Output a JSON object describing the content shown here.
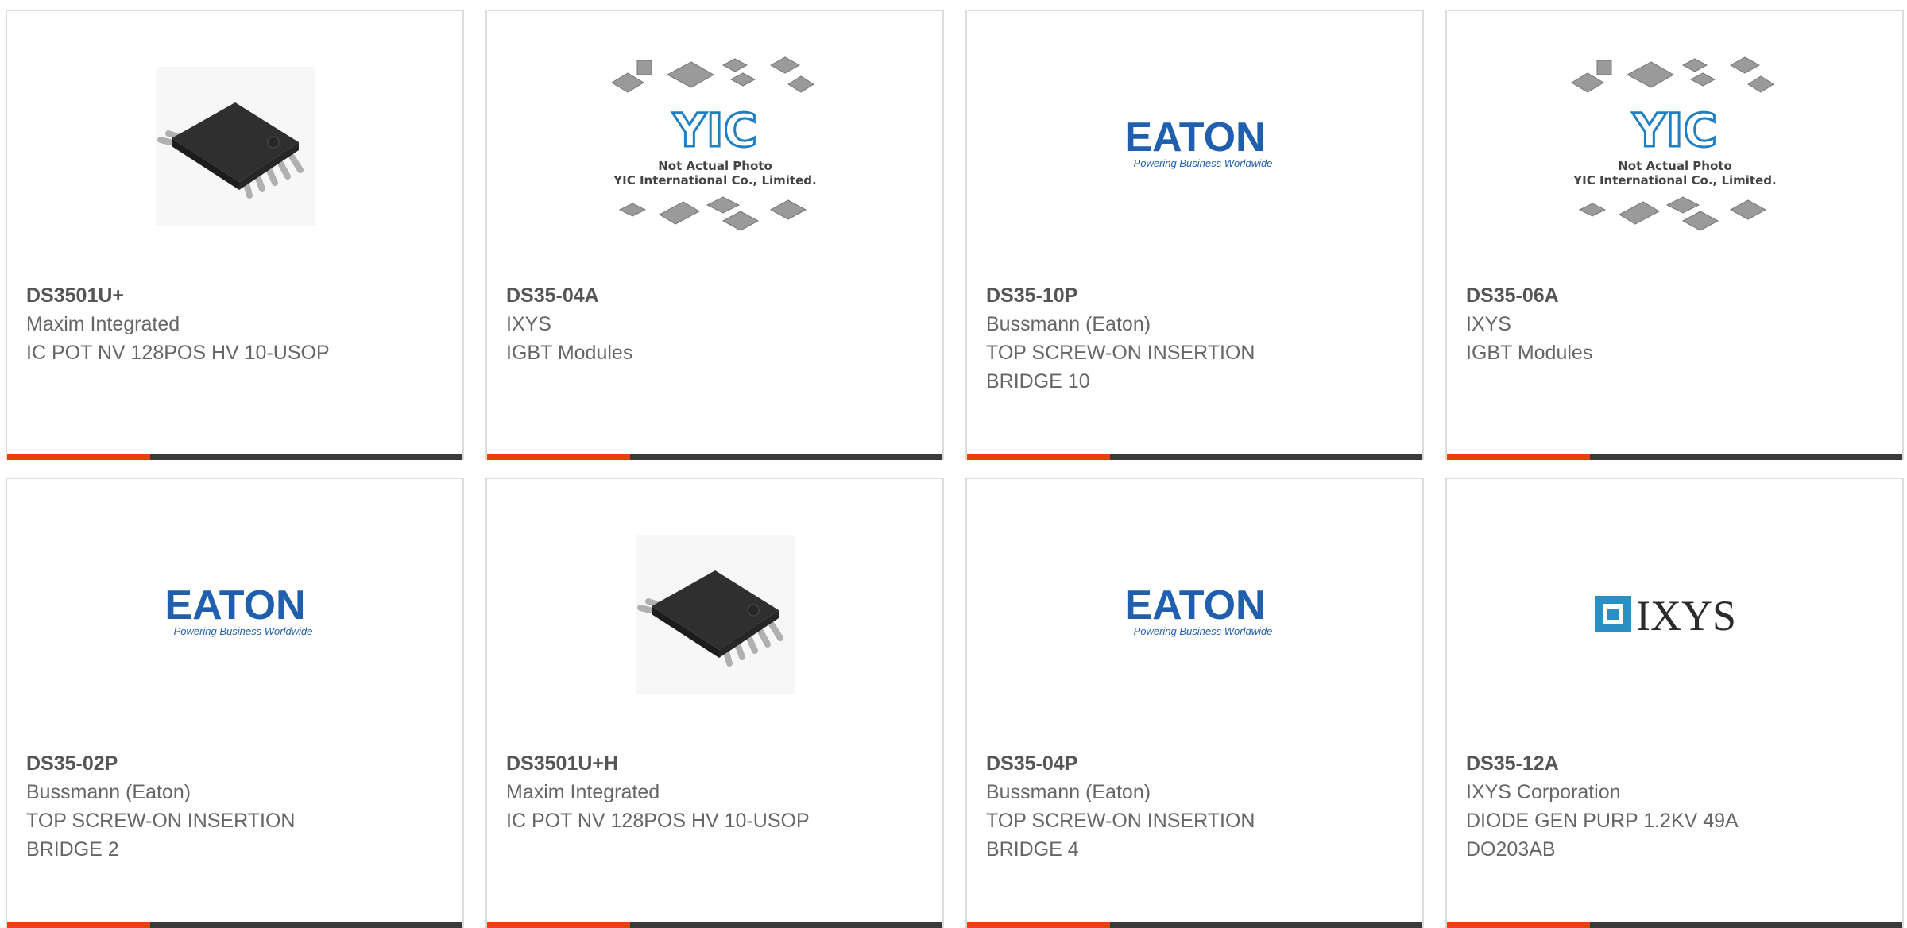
{
  "products": [
    {
      "part": "DS3501U+",
      "manufacturer": "Maxim Integrated",
      "description": "IC POT NV 128POS HV 10-USOP",
      "image": "ic-chip"
    },
    {
      "part": "DS35-04A",
      "manufacturer": "IXYS",
      "description": "IGBT Modules",
      "image": "yic-placeholder"
    },
    {
      "part": "DS35-10P",
      "manufacturer": "Bussmann (Eaton)",
      "description": "TOP SCREW-ON INSERTION BRIDGE 10",
      "image": "eaton-logo"
    },
    {
      "part": "DS35-06A",
      "manufacturer": "IXYS",
      "description": "IGBT Modules",
      "image": "yic-placeholder"
    },
    {
      "part": "DS35-02P",
      "manufacturer": "Bussmann (Eaton)",
      "description": "TOP SCREW-ON INSERTION BRIDGE 2",
      "image": "eaton-logo"
    },
    {
      "part": "DS3501U+H",
      "manufacturer": "Maxim Integrated",
      "description": "IC POT NV 128POS HV 10-USOP",
      "image": "ic-chip"
    },
    {
      "part": "DS35-04P",
      "manufacturer": "Bussmann (Eaton)",
      "description": "TOP SCREW-ON INSERTION BRIDGE 4",
      "image": "eaton-logo"
    },
    {
      "part": "DS35-12A",
      "manufacturer": "IXYS Corporation",
      "description": "DIODE GEN PURP 1.2KV 49A DO203AB",
      "image": "ixys-logo"
    }
  ],
  "logos": {
    "eaton_name": "EATON",
    "eaton_tagline": "Powering Business Worldwide",
    "yic_name": "YIC",
    "yic_line1": "Not Actual Photo",
    "yic_line2": "YIC International Co., Limited.",
    "ixys_name": "IXYS"
  },
  "colors": {
    "accent": "#e8410f",
    "bar": "#3b3b3b",
    "eaton_blue": "#1f5fae",
    "yic_blue": "#1e7fc3"
  }
}
